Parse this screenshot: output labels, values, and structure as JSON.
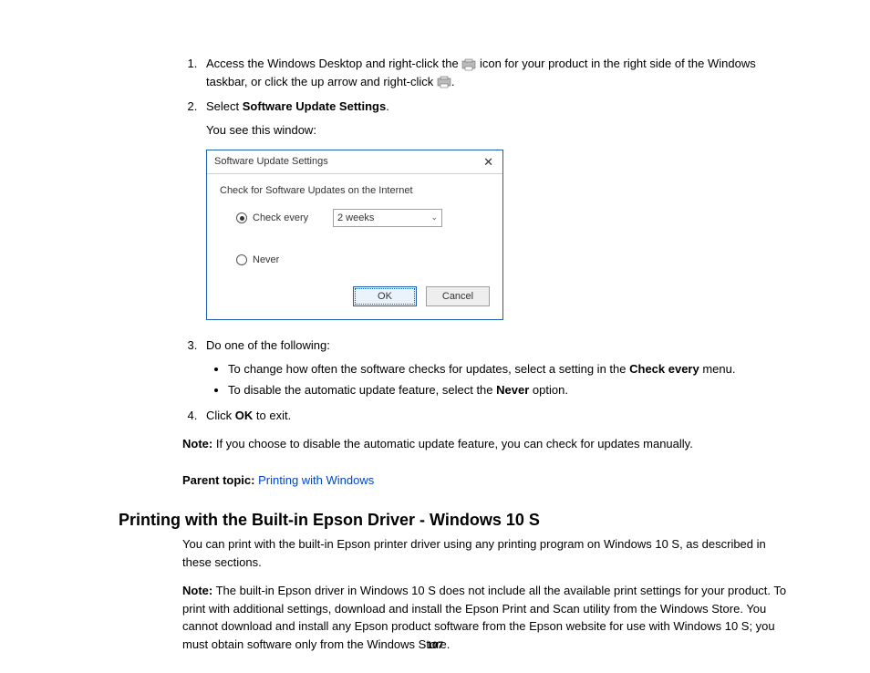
{
  "steps": {
    "s1_a": "Access the Windows Desktop and right-click the ",
    "s1_b": " icon for your product in the right side of the Windows taskbar, or click the up arrow and right-click ",
    "s1_c": ".",
    "s2_a": "Select ",
    "s2_bold": "Software Update Settings",
    "s2_b": ".",
    "s2_sub": "You see this window:",
    "s3": "Do one of the following:",
    "s3_b1_a": "To change how often the software checks for updates, select a setting in the ",
    "s3_b1_bold": "Check every",
    "s3_b1_b": " menu.",
    "s3_b2_a": "To disable the automatic update feature, select the ",
    "s3_b2_bold": "Never",
    "s3_b2_b": " option.",
    "s4_a": "Click ",
    "s4_bold": "OK",
    "s4_b": " to exit."
  },
  "dialog": {
    "title": "Software Update Settings",
    "heading": "Check for Software Updates on the Internet",
    "opt_check_every": "Check every",
    "select_value": "2 weeks",
    "opt_never": "Never",
    "ok": "OK",
    "cancel": "Cancel"
  },
  "note": {
    "label": "Note:",
    "text": " If you choose to disable the automatic update feature, you can check for updates manually."
  },
  "parent": {
    "label": "Parent topic:",
    "link": "Printing with Windows"
  },
  "section": {
    "heading": "Printing with the Built-in Epson Driver - Windows 10 S",
    "p1": "You can print with the built-in Epson printer driver using any printing program on Windows 10 S, as described in these sections.",
    "note_label": "Note:",
    "note_text": " The built-in Epson driver in Windows 10 S does not include all the available print settings for your product. To print with additional settings, download and install the Epson Print and Scan utility from the Windows Store. You cannot download and install any Epson product software from the Epson website for use with Windows 10 S; you must obtain software only from the Windows Store."
  },
  "page_number": "107"
}
